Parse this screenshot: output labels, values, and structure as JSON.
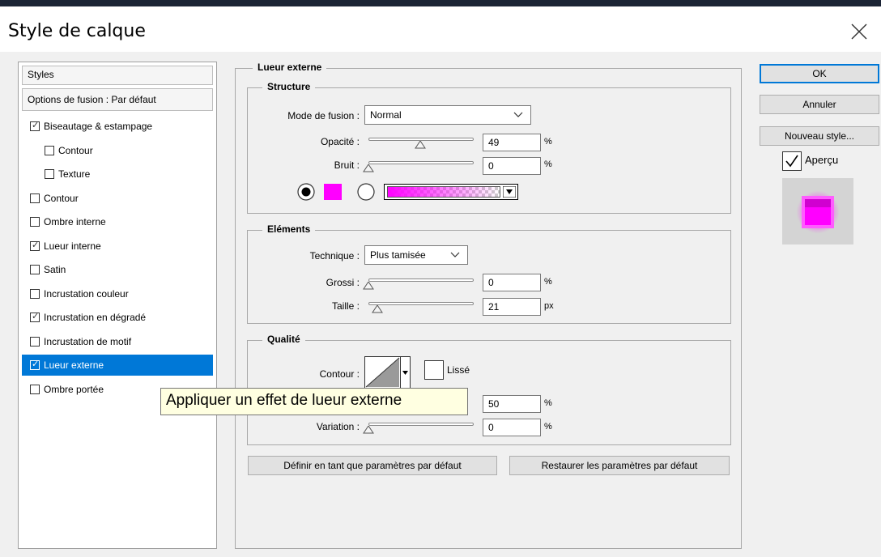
{
  "dialog": {
    "title": "Style de calque",
    "close_icon": "close-icon"
  },
  "styles_panel": {
    "header": "Styles",
    "options": "Options de fusion : Par défaut",
    "items": [
      {
        "label": "Biseautage & estampage",
        "checked": true,
        "sub": false
      },
      {
        "label": "Contour",
        "checked": false,
        "sub": true
      },
      {
        "label": "Texture",
        "checked": false,
        "sub": true
      },
      {
        "label": "Contour",
        "checked": false,
        "sub": false
      },
      {
        "label": "Ombre interne",
        "checked": false,
        "sub": false
      },
      {
        "label": "Lueur interne",
        "checked": true,
        "sub": false
      },
      {
        "label": "Satin",
        "checked": false,
        "sub": false
      },
      {
        "label": "Incrustation couleur",
        "checked": false,
        "sub": false
      },
      {
        "label": "Incrustation en dégradé",
        "checked": true,
        "sub": false
      },
      {
        "label": "Incrustation de motif",
        "checked": false,
        "sub": false
      },
      {
        "label": "Lueur externe",
        "checked": true,
        "sub": false,
        "selected": true
      },
      {
        "label": "Ombre portée",
        "checked": false,
        "sub": false
      }
    ]
  },
  "main": {
    "group_title": "Lueur externe",
    "structure": {
      "title": "Structure",
      "blend_mode_label": "Mode de fusion :",
      "blend_mode_value": "Normal",
      "opacity_label": "Opacité :",
      "opacity_value": "49",
      "opacity_unit": "%",
      "opacity_level": 0.49,
      "noise_label": "Bruit :",
      "noise_value": "0",
      "noise_unit": "%",
      "noise_level": 0,
      "color_swatch": "#ff00ff",
      "color_radio_selected": true,
      "gradient_radio_selected": false
    },
    "elements": {
      "title": "Eléments",
      "technique_label": "Technique :",
      "technique_value": "Plus tamisée",
      "spread_label": "Grossi :",
      "spread_value": "0",
      "spread_unit": "%",
      "spread_level": 0,
      "size_label": "Taille :",
      "size_value": "21",
      "size_unit": "px",
      "size_level": 0.084
    },
    "quality": {
      "title": "Qualité",
      "contour_label": "Contour :",
      "antialias_label": "Lissé",
      "antialias_checked": false,
      "range_value": "50",
      "range_unit": "%",
      "range_level": 0.5,
      "jitter_label": "Variation :",
      "jitter_value": "0",
      "jitter_unit": "%",
      "jitter_level": 0
    },
    "make_default_label": "Définir en tant que paramètres par défaut",
    "reset_default_label": "Restaurer les paramètres par défaut"
  },
  "right_panel": {
    "ok_label": "OK",
    "cancel_label": "Annuler",
    "new_style_label": "Nouveau style...",
    "preview_label": "Aperçu",
    "preview_checked": true,
    "accent_color": "#ff00ff"
  },
  "tooltip": {
    "text": "Appliquer un effet de lueur externe"
  }
}
